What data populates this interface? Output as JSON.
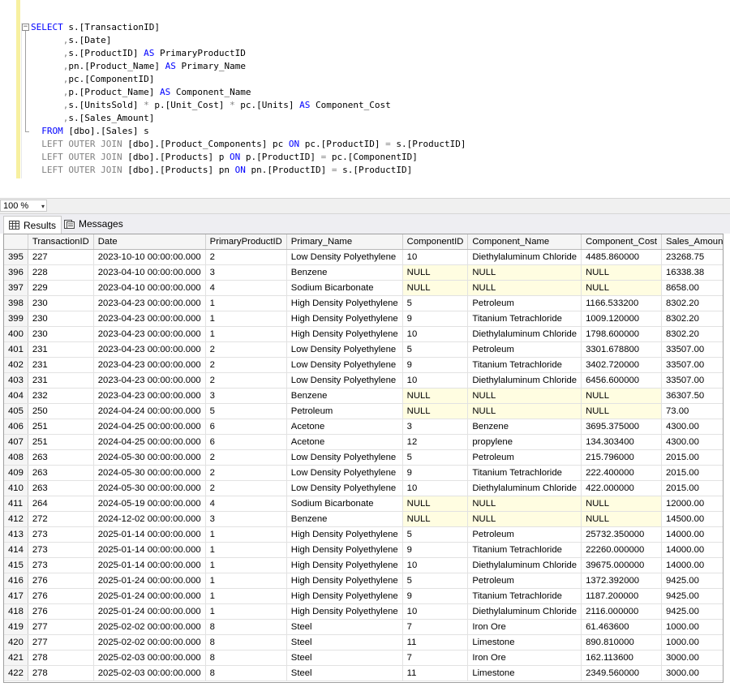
{
  "editor": {
    "lines": [
      [
        [
          "kw",
          "SELECT"
        ],
        [
          "t",
          " s.[TransactionID]"
        ]
      ],
      [
        [
          "t",
          "      "
        ],
        [
          "op",
          ","
        ],
        [
          "t",
          "s.[Date]"
        ]
      ],
      [
        [
          "t",
          "      "
        ],
        [
          "op",
          ","
        ],
        [
          "t",
          "s.[ProductID] "
        ],
        [
          "kw",
          "AS"
        ],
        [
          "t",
          " PrimaryProductID"
        ]
      ],
      [
        [
          "t",
          "      "
        ],
        [
          "op",
          ","
        ],
        [
          "t",
          "pn.[Product_Name] "
        ],
        [
          "kw",
          "AS"
        ],
        [
          "t",
          " Primary_Name"
        ]
      ],
      [
        [
          "t",
          "      "
        ],
        [
          "op",
          ","
        ],
        [
          "t",
          "pc.[ComponentID]"
        ]
      ],
      [
        [
          "t",
          "      "
        ],
        [
          "op",
          ","
        ],
        [
          "t",
          "p.[Product_Name] "
        ],
        [
          "kw",
          "AS"
        ],
        [
          "t",
          " Component_Name"
        ]
      ],
      [
        [
          "t",
          "      "
        ],
        [
          "op",
          ","
        ],
        [
          "t",
          "s.[UnitsSold] "
        ],
        [
          "op",
          "*"
        ],
        [
          "t",
          " p.[Unit_Cost] "
        ],
        [
          "op",
          "*"
        ],
        [
          "t",
          " pc.[Units] "
        ],
        [
          "kw",
          "AS"
        ],
        [
          "t",
          " Component_Cost"
        ]
      ],
      [
        [
          "t",
          "      "
        ],
        [
          "op",
          ","
        ],
        [
          "t",
          "s.[Sales_Amount]"
        ]
      ],
      [
        [
          "t",
          "  "
        ],
        [
          "kw",
          "FROM"
        ],
        [
          "t",
          " [dbo].[Sales] s"
        ]
      ],
      [
        [
          "t",
          "  "
        ],
        [
          "g",
          "LEFT OUTER JOIN"
        ],
        [
          "t",
          " [dbo].[Product_Components] pc "
        ],
        [
          "kw",
          "ON"
        ],
        [
          "t",
          " pc.[ProductID] "
        ],
        [
          "op",
          "="
        ],
        [
          "t",
          " s.[ProductID]"
        ]
      ],
      [
        [
          "t",
          "  "
        ],
        [
          "g",
          "LEFT OUTER JOIN"
        ],
        [
          "t",
          " [dbo].[Products] p "
        ],
        [
          "kw",
          "ON"
        ],
        [
          "t",
          " p.[ProductID] "
        ],
        [
          "op",
          "="
        ],
        [
          "t",
          " pc.[ComponentID]"
        ]
      ],
      [
        [
          "t",
          "  "
        ],
        [
          "g",
          "LEFT OUTER JOIN"
        ],
        [
          "t",
          " [dbo].[Products] pn "
        ],
        [
          "kw",
          "ON"
        ],
        [
          "t",
          " pn.[ProductID] "
        ],
        [
          "op",
          "="
        ],
        [
          "t",
          " s.[ProductID]"
        ]
      ]
    ],
    "collapse_glyph": "−"
  },
  "zoom": {
    "value": "100 %",
    "arrow": "▾"
  },
  "tabs": [
    {
      "label": "Results",
      "icon": "grid-icon",
      "active": true
    },
    {
      "label": "Messages",
      "icon": "messages-icon",
      "active": false
    }
  ],
  "grid": {
    "columns": [
      "TransactionID",
      "Date",
      "PrimaryProductID",
      "Primary_Name",
      "ComponentID",
      "Component_Name",
      "Component_Cost",
      "Sales_Amount"
    ],
    "rows": [
      [
        "395",
        "227",
        "2023-10-10 00:00:00.000",
        "2",
        "Low Density Polyethylene",
        "10",
        "Diethylaluminum Chloride",
        "4485.860000",
        "23268.75"
      ],
      [
        "396",
        "228",
        "2023-04-10 00:00:00.000",
        "3",
        "Benzene",
        "NULL",
        "NULL",
        "NULL",
        "16338.38"
      ],
      [
        "397",
        "229",
        "2023-04-10 00:00:00.000",
        "4",
        "Sodium Bicarbonate",
        "NULL",
        "NULL",
        "NULL",
        "8658.00"
      ],
      [
        "398",
        "230",
        "2023-04-23 00:00:00.000",
        "1",
        "High Density Polyethylene",
        "5",
        "Petroleum",
        "1166.533200",
        "8302.20"
      ],
      [
        "399",
        "230",
        "2023-04-23 00:00:00.000",
        "1",
        "High Density Polyethylene",
        "9",
        "Titanium Tetrachloride",
        "1009.120000",
        "8302.20"
      ],
      [
        "400",
        "230",
        "2023-04-23 00:00:00.000",
        "1",
        "High Density Polyethylene",
        "10",
        "Diethylaluminum Chloride",
        "1798.600000",
        "8302.20"
      ],
      [
        "401",
        "231",
        "2023-04-23 00:00:00.000",
        "2",
        "Low Density Polyethylene",
        "5",
        "Petroleum",
        "3301.678800",
        "33507.00"
      ],
      [
        "402",
        "231",
        "2023-04-23 00:00:00.000",
        "2",
        "Low Density Polyethylene",
        "9",
        "Titanium Tetrachloride",
        "3402.720000",
        "33507.00"
      ],
      [
        "403",
        "231",
        "2023-04-23 00:00:00.000",
        "2",
        "Low Density Polyethylene",
        "10",
        "Diethylaluminum Chloride",
        "6456.600000",
        "33507.00"
      ],
      [
        "404",
        "232",
        "2023-04-23 00:00:00.000",
        "3",
        "Benzene",
        "NULL",
        "NULL",
        "NULL",
        "36307.50"
      ],
      [
        "405",
        "250",
        "2024-04-24 00:00:00.000",
        "5",
        "Petroleum",
        "NULL",
        "NULL",
        "NULL",
        "73.00"
      ],
      [
        "406",
        "251",
        "2024-04-25 00:00:00.000",
        "6",
        "Acetone",
        "3",
        "Benzene",
        "3695.375000",
        "4300.00"
      ],
      [
        "407",
        "251",
        "2024-04-25 00:00:00.000",
        "6",
        "Acetone",
        "12",
        "propylene",
        "134.303400",
        "4300.00"
      ],
      [
        "408",
        "263",
        "2024-05-30 00:00:00.000",
        "2",
        "Low Density Polyethylene",
        "5",
        "Petroleum",
        "215.796000",
        "2015.00"
      ],
      [
        "409",
        "263",
        "2024-05-30 00:00:00.000",
        "2",
        "Low Density Polyethylene",
        "9",
        "Titanium Tetrachloride",
        "222.400000",
        "2015.00"
      ],
      [
        "410",
        "263",
        "2024-05-30 00:00:00.000",
        "2",
        "Low Density Polyethylene",
        "10",
        "Diethylaluminum Chloride",
        "422.000000",
        "2015.00"
      ],
      [
        "411",
        "264",
        "2024-05-19 00:00:00.000",
        "4",
        "Sodium Bicarbonate",
        "NULL",
        "NULL",
        "NULL",
        "12000.00"
      ],
      [
        "412",
        "272",
        "2024-12-02 00:00:00.000",
        "3",
        "Benzene",
        "NULL",
        "NULL",
        "NULL",
        "14500.00"
      ],
      [
        "413",
        "273",
        "2025-01-14 00:00:00.000",
        "1",
        "High Density Polyethylene",
        "5",
        "Petroleum",
        "25732.350000",
        "14000.00"
      ],
      [
        "414",
        "273",
        "2025-01-14 00:00:00.000",
        "1",
        "High Density Polyethylene",
        "9",
        "Titanium Tetrachloride",
        "22260.000000",
        "14000.00"
      ],
      [
        "415",
        "273",
        "2025-01-14 00:00:00.000",
        "1",
        "High Density Polyethylene",
        "10",
        "Diethylaluminum Chloride",
        "39675.000000",
        "14000.00"
      ],
      [
        "416",
        "276",
        "2025-01-24 00:00:00.000",
        "1",
        "High Density Polyethylene",
        "5",
        "Petroleum",
        "1372.392000",
        "9425.00"
      ],
      [
        "417",
        "276",
        "2025-01-24 00:00:00.000",
        "1",
        "High Density Polyethylene",
        "9",
        "Titanium Tetrachloride",
        "1187.200000",
        "9425.00"
      ],
      [
        "418",
        "276",
        "2025-01-24 00:00:00.000",
        "1",
        "High Density Polyethylene",
        "10",
        "Diethylaluminum Chloride",
        "2116.000000",
        "9425.00"
      ],
      [
        "419",
        "277",
        "2025-02-02 00:00:00.000",
        "8",
        "Steel",
        "7",
        "Iron Ore",
        "61.463600",
        "1000.00"
      ],
      [
        "420",
        "277",
        "2025-02-02 00:00:00.000",
        "8",
        "Steel",
        "11",
        "Limestone",
        "890.810000",
        "1000.00"
      ],
      [
        "421",
        "278",
        "2025-02-03 00:00:00.000",
        "8",
        "Steel",
        "7",
        "Iron Ore",
        "162.113600",
        "3000.00"
      ],
      [
        "422",
        "278",
        "2025-02-03 00:00:00.000",
        "8",
        "Steel",
        "11",
        "Limestone",
        "2349.560000",
        "3000.00"
      ]
    ],
    "null_color": "#fffde1"
  }
}
